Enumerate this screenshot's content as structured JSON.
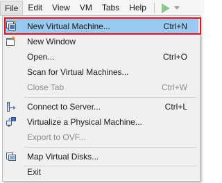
{
  "menubar": {
    "items": [
      {
        "label": "File"
      },
      {
        "label": "Edit"
      },
      {
        "label": "View"
      },
      {
        "label": "VM"
      },
      {
        "label": "Tabs"
      },
      {
        "label": "Help"
      }
    ],
    "run_icon": "play-icon",
    "run_dropdown_icon": "chevron-down-icon"
  },
  "file_menu": {
    "items": [
      {
        "label": "New Virtual Machine...",
        "shortcut": "Ctrl+N",
        "icon": "new-vm-icon",
        "enabled": true,
        "highlighted": true
      },
      {
        "label": "New Window",
        "shortcut": "",
        "icon": "new-window-icon",
        "enabled": true
      },
      {
        "label": "Open...",
        "shortcut": "Ctrl+O",
        "icon": "",
        "enabled": true
      },
      {
        "label": "Scan for Virtual Machines...",
        "shortcut": "",
        "icon": "",
        "enabled": true
      },
      {
        "label": "Close Tab",
        "shortcut": "Ctrl+W",
        "icon": "",
        "enabled": false
      },
      {
        "label": "Connect to Server...",
        "shortcut": "Ctrl+L",
        "icon": "connect-server-icon",
        "enabled": true
      },
      {
        "label": "Virtualize a Physical Machine...",
        "shortcut": "",
        "icon": "virtualize-physical-icon",
        "enabled": true
      },
      {
        "label": "Export to OVF...",
        "shortcut": "",
        "icon": "",
        "enabled": false
      },
      {
        "label": "Map Virtual Disks...",
        "shortcut": "",
        "icon": "map-disks-icon",
        "enabled": true
      },
      {
        "label": "Exit",
        "shortcut": "",
        "icon": "",
        "enabled": true
      }
    ]
  },
  "colors": {
    "highlight": "#99c8f0",
    "annotation_frame": "#e0141e",
    "disabled_text": "#8a8a8a"
  }
}
